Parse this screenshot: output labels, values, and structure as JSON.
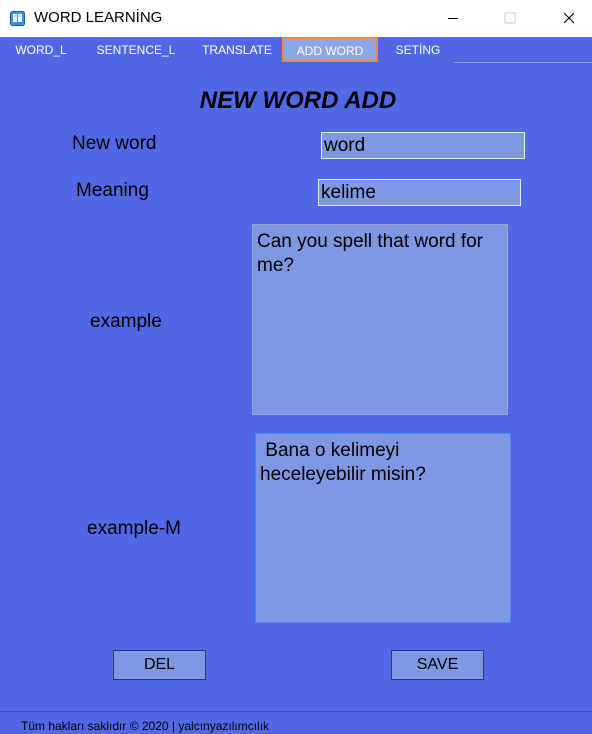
{
  "window": {
    "title": "WORD LEARNİNG",
    "icon": "book-app-icon",
    "minimize_icon": "minimize-icon",
    "maximize_icon": "maximize-icon",
    "close_icon": "close-icon"
  },
  "menu": {
    "tabs": [
      {
        "label": "WORD_L"
      },
      {
        "label": "SENTENCE_L"
      },
      {
        "label": "TRANSLATE"
      },
      {
        "label": "ADD WORD"
      },
      {
        "label": "SETİNG"
      }
    ],
    "active_tab": "ADD WORD",
    "active_border_color": "#F0893E"
  },
  "form": {
    "heading": "NEW WORD ADD",
    "new_word_label": "New word",
    "new_word_value": "word",
    "meaning_label": "Meaning",
    "meaning_value": "kelime",
    "example_label": "example",
    "example_value": "Can you spell that word for me?",
    "example_m_label": "example-M",
    "example_m_value": " Bana o kelimeyi heceleyebilir misin?"
  },
  "buttons": {
    "del_label": "DEL",
    "save_label": "SAVE"
  },
  "status": {
    "text": "Tüm hakları saklıdır © 2020 | yalcınyazılımcılık"
  },
  "colors": {
    "background": "#5068E6",
    "field": "#7F96E2",
    "accent": "#F0893E"
  }
}
